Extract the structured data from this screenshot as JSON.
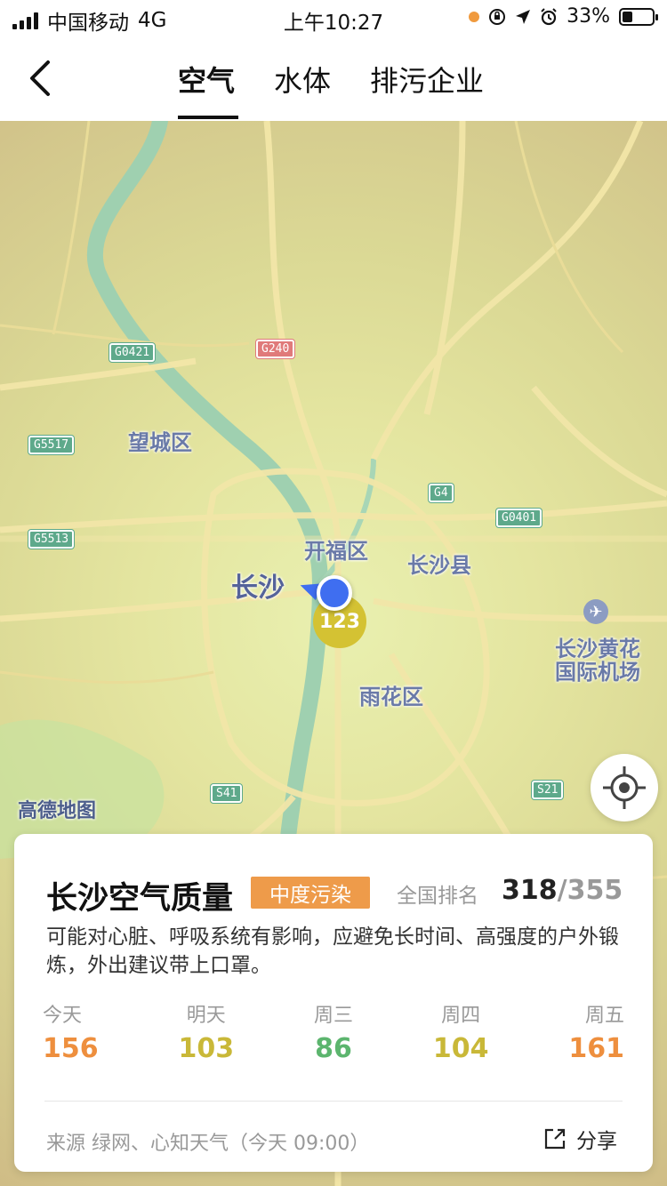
{
  "status_bar": {
    "carrier": "中国移动",
    "network": "4G",
    "time": "上午10:27",
    "battery": "33%",
    "battery_level": 0.33
  },
  "nav": {
    "tabs": [
      {
        "label": "空气",
        "active": true
      },
      {
        "label": "水体",
        "active": false
      },
      {
        "label": "排污企业",
        "active": false
      }
    ]
  },
  "map": {
    "labels": {
      "changsha": "长沙",
      "wangcheng": "望城区",
      "kaifu": "开福区",
      "changsha_county": "长沙县",
      "yuhua": "雨花区",
      "airport_line1": "长沙黄花",
      "airport_line2": "国际机场"
    },
    "shields": {
      "g0421": "G0421",
      "g240": "G240",
      "g5517": "G5517",
      "g5513": "G5513",
      "g4": "G4",
      "g0401": "G0401",
      "s41": "S41",
      "s21": "S21"
    },
    "aqi_marker": "123",
    "provider_logo": "高德地图"
  },
  "card": {
    "title": "长沙空气质量",
    "level": "中度污染",
    "rank_label": "全国排名",
    "rank": "318",
    "rank_total": "/355",
    "description": "可能对心脏、呼吸系统有影响，应避免长时间、高强度的户外锻炼，外出建议带上口罩。",
    "forecast": [
      {
        "day": "今天",
        "value": "156",
        "color": "#ee8f3e"
      },
      {
        "day": "明天",
        "value": "103",
        "color": "#c9b838"
      },
      {
        "day": "周三",
        "value": "86",
        "color": "#5cb56e"
      },
      {
        "day": "周四",
        "value": "104",
        "color": "#c9b838"
      },
      {
        "day": "周五",
        "value": "161",
        "color": "#ee8f3e"
      }
    ],
    "source": "来源 绿网、心知天气（今天 09:00）",
    "share_label": "分享"
  },
  "colors": {
    "accent_orange": "#ee9b4a",
    "location_blue": "#3f6ef0",
    "aqi_marker_yellow": "#d4c233"
  }
}
